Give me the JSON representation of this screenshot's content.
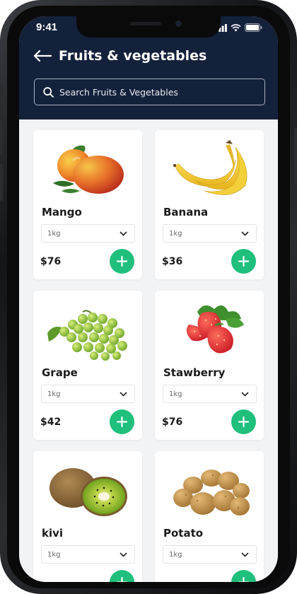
{
  "status_bar": {
    "time": "9:41"
  },
  "header": {
    "title": "Fruits & vegetables",
    "search_placeholder": "Search Fruits & Vegetables"
  },
  "colors": {
    "header_bg": "#14213b",
    "accent_green": "#1fbf7c",
    "card_bg": "#ffffff",
    "page_bg": "#f2f3f5"
  },
  "products": [
    {
      "name": "Mango",
      "quantity": "1kg",
      "price": "$76",
      "image": "mango-image"
    },
    {
      "name": "Banana",
      "quantity": "1kg",
      "price": "$36",
      "image": "banana-image"
    },
    {
      "name": "Grape",
      "quantity": "1kg",
      "price": "$42",
      "image": "grape-image"
    },
    {
      "name": "Stawberry",
      "quantity": "1kg",
      "price": "$76",
      "image": "strawberry-image"
    },
    {
      "name": "kivi",
      "quantity": "1kg",
      "price": "",
      "image": "kiwi-image"
    },
    {
      "name": "Potato",
      "quantity": "1kg",
      "price": "",
      "image": "potato-image"
    }
  ]
}
